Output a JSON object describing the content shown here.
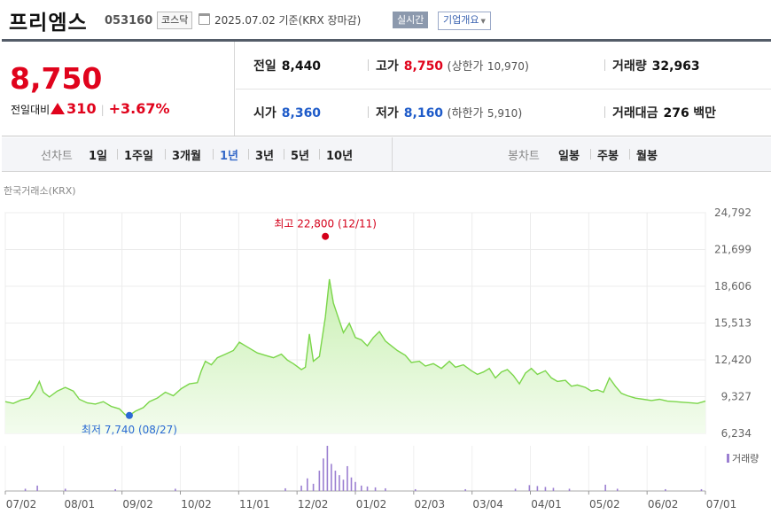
{
  "header": {
    "name": "프리엠스",
    "code": "053160",
    "market": "코스닥",
    "date": "2025.07.02  기준(KRX 장마감)",
    "realtime_label": "실시간",
    "overview_label": "기업개요"
  },
  "quote": {
    "price": "8,750",
    "diff_label": "전일대비",
    "change": "310",
    "change_pct": "+3.67%",
    "prev_close_label": "전일",
    "prev_close": "8,440",
    "high_label": "고가",
    "high": "8,750",
    "upper_label": "(상한가",
    "upper": "10,970",
    "upper_close": ")",
    "volume_label": "거래량",
    "volume": "32,963",
    "open_label": "시가",
    "open": "8,360",
    "low_label": "저가",
    "low": "8,160",
    "lower_label": "(하한가",
    "lower": "5,910",
    "lower_close": ")",
    "amount_label": "거래대금",
    "amount": "276",
    "amount_unit": "백만",
    "colors": {
      "up": "#e0031c",
      "down": "#1e5bc9"
    }
  },
  "tabs": {
    "line_label": "선차트",
    "periods": [
      "1일",
      "1주일",
      "3개월",
      "1년",
      "3년",
      "5년",
      "10년"
    ],
    "active_period": "1년",
    "candle_label": "봉차트",
    "candles": [
      "일봉",
      "주봉",
      "월봉"
    ]
  },
  "source": "한국거래소(KRX)",
  "chart_data": {
    "type": "area",
    "title": "",
    "xlabel": "",
    "ylabel": "",
    "x_ticks": [
      "07/02",
      "08/01",
      "09/02",
      "10/02",
      "11/01",
      "12/02",
      "01/02",
      "02/03",
      "03/04",
      "04/01",
      "05/02",
      "06/02",
      "07/01"
    ],
    "y_ticks": [
      24792,
      21699,
      18606,
      15513,
      12420,
      9327,
      6234
    ],
    "ylim": [
      6234,
      24792
    ],
    "grid": true,
    "series": [
      {
        "name": "",
        "values": [
          [
            0,
            8900
          ],
          [
            4,
            8750
          ],
          [
            8,
            9050
          ],
          [
            12,
            9200
          ],
          [
            15,
            9900
          ],
          [
            17,
            10600
          ],
          [
            19,
            9700
          ],
          [
            22,
            9300
          ],
          [
            26,
            9800
          ],
          [
            30,
            10100
          ],
          [
            34,
            9800
          ],
          [
            37,
            9100
          ],
          [
            41,
            8800
          ],
          [
            45,
            8700
          ],
          [
            49,
            8900
          ],
          [
            53,
            8500
          ],
          [
            57,
            8300
          ],
          [
            60,
            7800
          ],
          [
            62,
            7740
          ],
          [
            65,
            8100
          ],
          [
            69,
            8400
          ],
          [
            72,
            8900
          ],
          [
            76,
            9200
          ],
          [
            80,
            9700
          ],
          [
            84,
            9400
          ],
          [
            88,
            10000
          ],
          [
            92,
            10400
          ],
          [
            96,
            10500
          ],
          [
            98,
            11500
          ],
          [
            100,
            12300
          ],
          [
            103,
            12000
          ],
          [
            106,
            12600
          ],
          [
            110,
            12900
          ],
          [
            114,
            13200
          ],
          [
            117,
            13900
          ],
          [
            120,
            13600
          ],
          [
            123,
            13300
          ],
          [
            126,
            13000
          ],
          [
            130,
            12800
          ],
          [
            134,
            12600
          ],
          [
            138,
            12900
          ],
          [
            141,
            12400
          ],
          [
            144,
            12100
          ],
          [
            148,
            11600
          ],
          [
            150,
            11800
          ],
          [
            152,
            14600
          ],
          [
            154,
            12300
          ],
          [
            157,
            12700
          ],
          [
            160,
            16000
          ],
          [
            162,
            19200
          ],
          [
            164,
            17200
          ],
          [
            166,
            16200
          ],
          [
            169,
            14700
          ],
          [
            172,
            15500
          ],
          [
            175,
            14300
          ],
          [
            178,
            14100
          ],
          [
            181,
            13600
          ],
          [
            184,
            14300
          ],
          [
            187,
            14800
          ],
          [
            190,
            14000
          ],
          [
            193,
            13600
          ],
          [
            196,
            13200
          ],
          [
            200,
            12800
          ],
          [
            203,
            12200
          ],
          [
            207,
            12300
          ],
          [
            210,
            11900
          ],
          [
            214,
            12100
          ],
          [
            218,
            11700
          ],
          [
            222,
            12300
          ],
          [
            225,
            11800
          ],
          [
            229,
            12000
          ],
          [
            233,
            11500
          ],
          [
            236,
            11200
          ],
          [
            239,
            11400
          ],
          [
            242,
            11700
          ],
          [
            245,
            10900
          ],
          [
            248,
            11400
          ],
          [
            251,
            11600
          ],
          [
            254,
            11100
          ],
          [
            257,
            10400
          ],
          [
            260,
            11300
          ],
          [
            263,
            11700
          ],
          [
            266,
            11200
          ],
          [
            270,
            11500
          ],
          [
            273,
            10900
          ],
          [
            276,
            10600
          ],
          [
            280,
            10700
          ],
          [
            283,
            10200
          ],
          [
            286,
            10300
          ],
          [
            290,
            10100
          ],
          [
            293,
            9800
          ],
          [
            296,
            9900
          ],
          [
            299,
            9700
          ],
          [
            302,
            10900
          ],
          [
            305,
            10200
          ],
          [
            308,
            9600
          ],
          [
            311,
            9400
          ],
          [
            315,
            9200
          ],
          [
            319,
            9100
          ],
          [
            323,
            9000
          ],
          [
            327,
            9100
          ],
          [
            331,
            8950
          ],
          [
            335,
            8900
          ],
          [
            339,
            8850
          ],
          [
            343,
            8800
          ],
          [
            346,
            8750
          ],
          [
            350,
            8950
          ]
        ]
      }
    ],
    "volume_series": {
      "name": "거래량",
      "values": [
        [
          10,
          0.05
        ],
        [
          16,
          0.12
        ],
        [
          30,
          0.05
        ],
        [
          55,
          0.04
        ],
        [
          85,
          0.05
        ],
        [
          140,
          0.06
        ],
        [
          148,
          0.12
        ],
        [
          151,
          0.28
        ],
        [
          154,
          0.16
        ],
        [
          157,
          0.45
        ],
        [
          159,
          0.72
        ],
        [
          161,
          1.0
        ],
        [
          163,
          0.6
        ],
        [
          165,
          0.45
        ],
        [
          167,
          0.35
        ],
        [
          169,
          0.25
        ],
        [
          171,
          0.55
        ],
        [
          173,
          0.3
        ],
        [
          175,
          0.2
        ],
        [
          178,
          0.12
        ],
        [
          181,
          0.1
        ],
        [
          185,
          0.08
        ],
        [
          190,
          0.06
        ],
        [
          205,
          0.04
        ],
        [
          230,
          0.04
        ],
        [
          255,
          0.05
        ],
        [
          262,
          0.13
        ],
        [
          266,
          0.11
        ],
        [
          270,
          0.09
        ],
        [
          274,
          0.07
        ],
        [
          282,
          0.05
        ],
        [
          300,
          0.14
        ],
        [
          306,
          0.05
        ],
        [
          330,
          0.04
        ],
        [
          348,
          0.04
        ]
      ]
    },
    "annotations": {
      "high_label": "최고 22,800 (12/11)",
      "high_value": 22800,
      "high_x": 160,
      "low_label": "최저 7,740 (08/27)",
      "low_value": 7740,
      "low_x": 62
    },
    "colors": {
      "line": "#7bd64a",
      "fill_top": "#c9f0b2",
      "fill_bottom": "#f3fcee",
      "high": "#d4001a",
      "low": "#2a6ad3",
      "volume": "#9b7fd1"
    }
  }
}
